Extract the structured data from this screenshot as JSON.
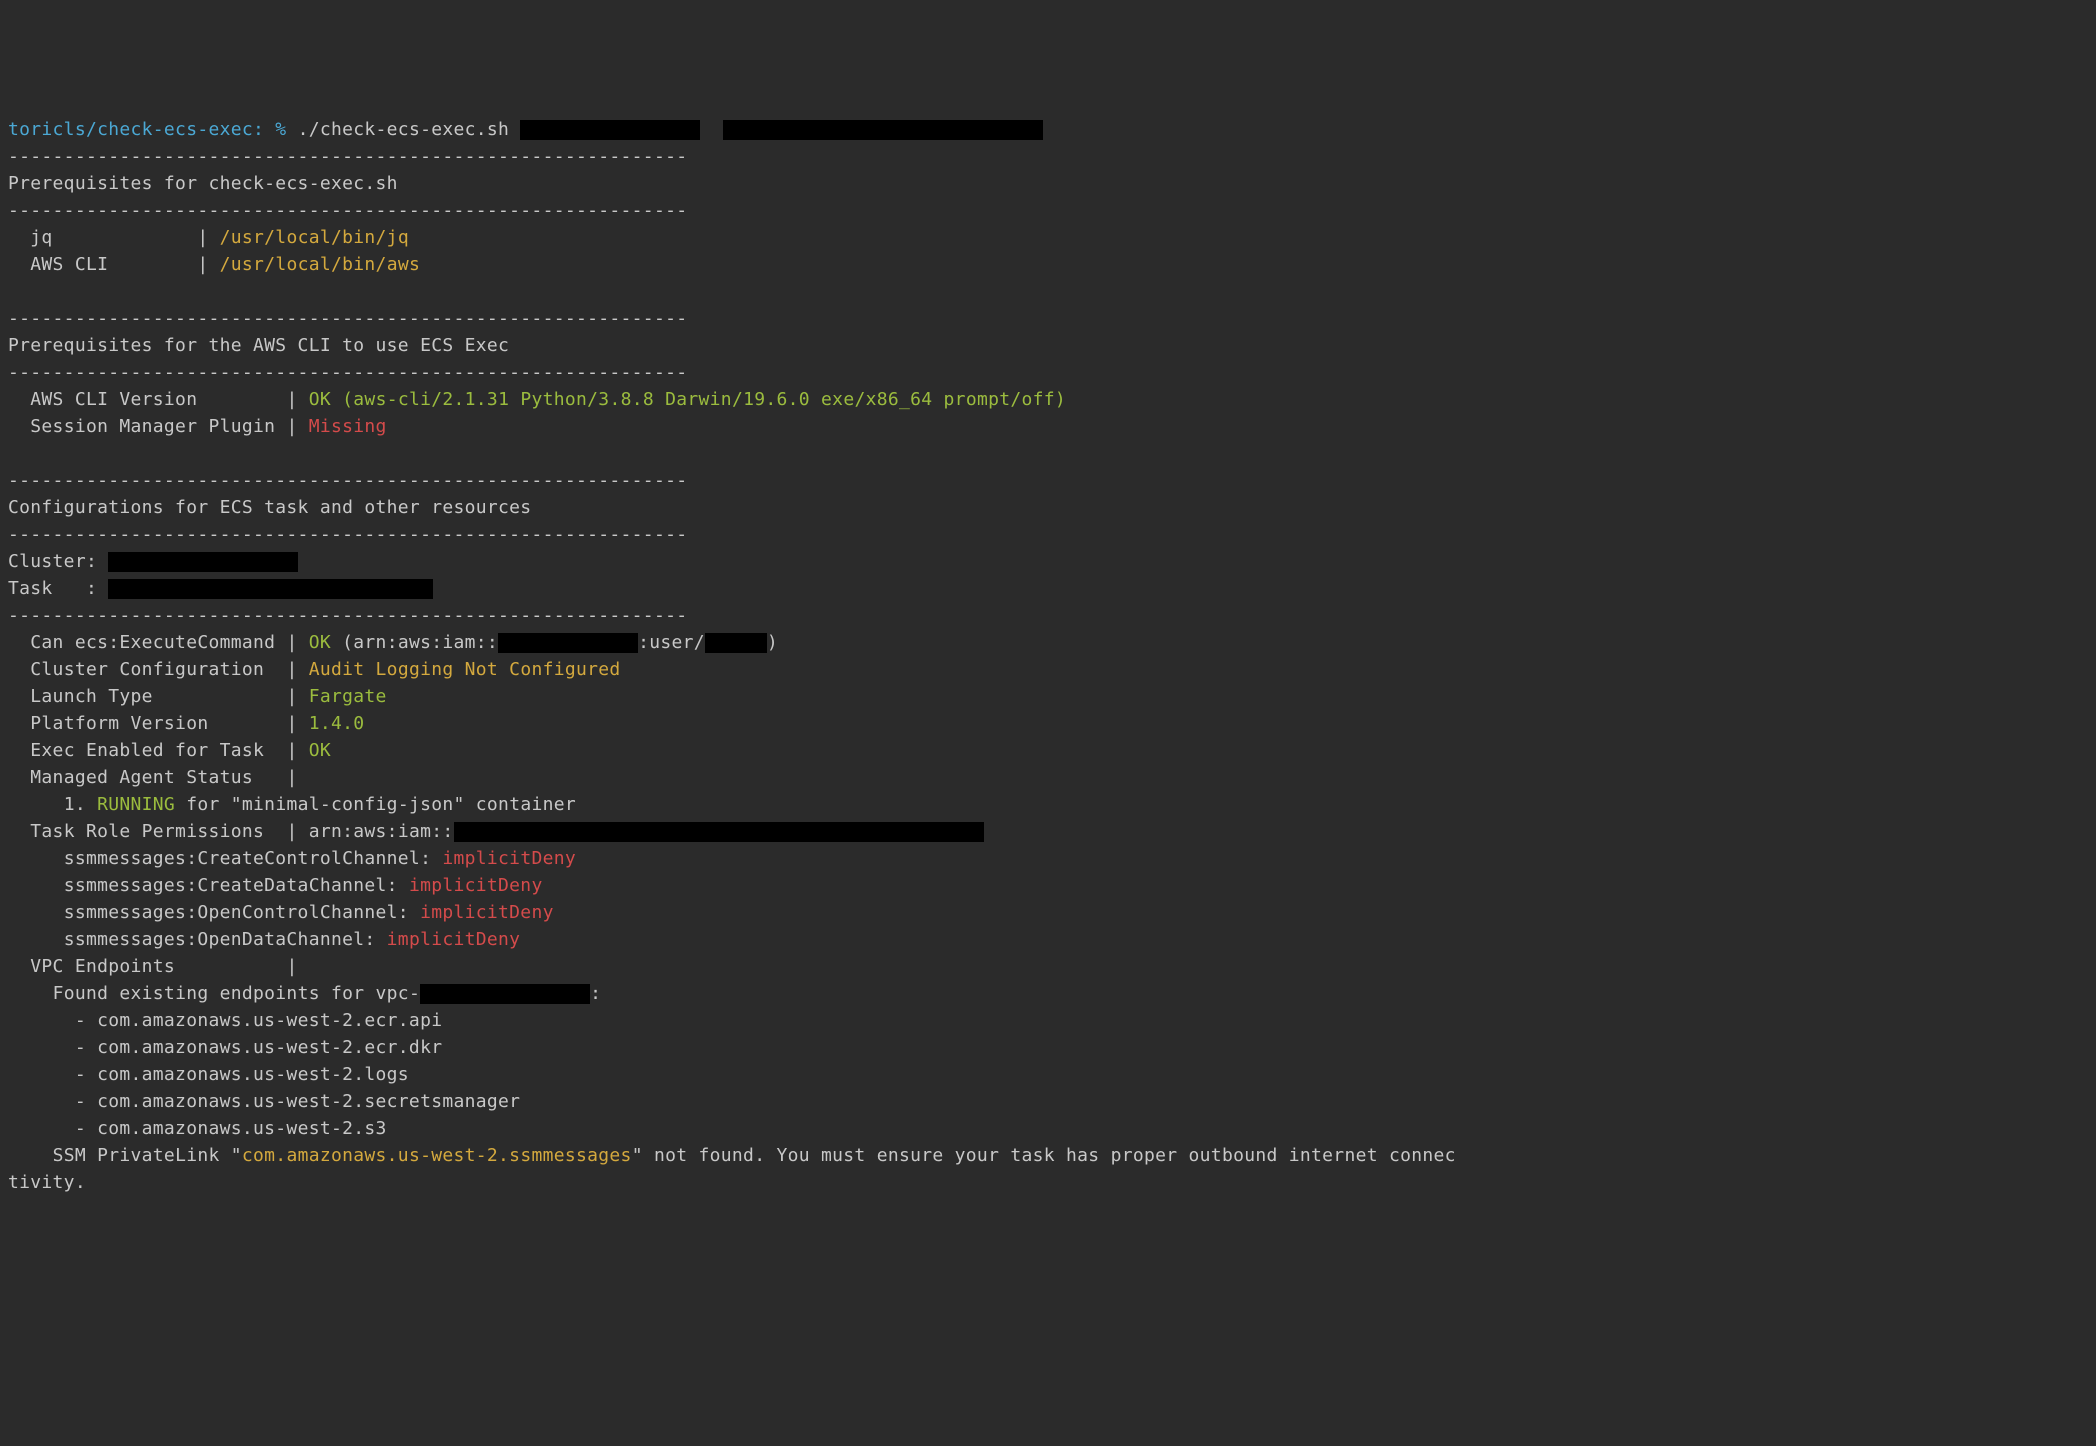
{
  "prompt": {
    "path": "toricls/check-ecs-exec:",
    "symbol": "%",
    "command": "./check-ecs-exec.sh"
  },
  "sections": {
    "divider": "-------------------------------------------------------------",
    "prereqScript": {
      "title": "Prerequisites for check-ecs-exec.sh",
      "jq": {
        "name": "jq",
        "sep": "|",
        "path": "/usr/local/bin/jq"
      },
      "awscli": {
        "name": "AWS CLI",
        "sep": "|",
        "path": "/usr/local/bin/aws"
      }
    },
    "prereqAws": {
      "title": "Prerequisites for the AWS CLI to use ECS Exec",
      "version": {
        "label": "AWS CLI Version",
        "sep": "|",
        "status": "OK",
        "detail": "(aws-cli/2.1.31 Python/3.8.8 Darwin/19.6.0 exe/x86_64 prompt/off)"
      },
      "session": {
        "label": "Session Manager Plugin",
        "sep": "|",
        "status": "Missing"
      }
    },
    "config": {
      "title": "Configurations for ECS task and other resources",
      "clusterLabel": "Cluster:",
      "taskLabel": "Task   :",
      "exec": {
        "label": "Can ecs:ExecuteCommand",
        "sep": "|",
        "status": "OK",
        "pre": "(arn:aws:iam::",
        "mid": ":user/",
        "post": ")"
      },
      "clusterConfig": {
        "label": "Cluster Configuration",
        "sep": "|",
        "status": "Audit Logging Not Configured"
      },
      "launchType": {
        "label": "Launch Type",
        "sep": "|",
        "value": "Fargate"
      },
      "platformVersion": {
        "label": "Platform Version",
        "sep": "|",
        "value": "1.4.0"
      },
      "execEnabled": {
        "label": "Exec Enabled for Task",
        "sep": "|",
        "status": "OK"
      },
      "managedAgent": {
        "label": "Managed Agent Status",
        "sep": "|",
        "itemNum": "1.",
        "status": "RUNNING",
        "detail": "for \"minimal-config-json\" container"
      },
      "taskRole": {
        "label": "Task Role Permissions",
        "sep": "|",
        "arnPrefix": "arn:aws:iam::",
        "perms": {
          "p1": {
            "action": "ssmmessages:CreateControlChannel:",
            "result": "implicitDeny"
          },
          "p2": {
            "action": "ssmmessages:CreateDataChannel:",
            "result": "implicitDeny"
          },
          "p3": {
            "action": "ssmmessages:OpenControlChannel:",
            "result": "implicitDeny"
          },
          "p4": {
            "action": "ssmmessages:OpenDataChannel:",
            "result": "implicitDeny"
          }
        }
      },
      "vpc": {
        "label": "VPC Endpoints",
        "sep": "|",
        "found": "Found existing endpoints for vpc-",
        "colon": ":",
        "e1": "- com.amazonaws.us-west-2.ecr.api",
        "e2": "- com.amazonaws.us-west-2.ecr.dkr",
        "e3": "- com.amazonaws.us-west-2.logs",
        "e4": "- com.amazonaws.us-west-2.secretsmanager",
        "e5": "- com.amazonaws.us-west-2.s3",
        "ssm": {
          "pre": "SSM PrivateLink \"",
          "name": "com.amazonaws.us-west-2.ssmmessages",
          "post1": "\" not found. You must ensure your task has proper outbound internet connec",
          "post2": "tivity."
        }
      }
    }
  }
}
